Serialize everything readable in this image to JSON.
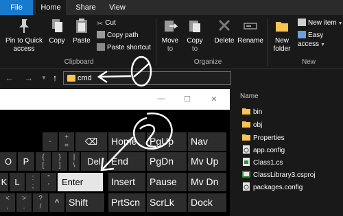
{
  "ribbon_tabs": {
    "file": "File",
    "home": "Home",
    "share": "Share",
    "view": "View"
  },
  "clipboard": {
    "pin_line1": "Pin to Quick",
    "pin_line2": "access",
    "copy": "Copy",
    "paste": "Paste",
    "cut": "Cut",
    "copy_path": "Copy path",
    "paste_shortcut": "Paste shortcut",
    "group_label": "Clipboard"
  },
  "organize": {
    "move_to_line1": "Move",
    "move_to_line2": "to",
    "copy_to_line1": "Copy",
    "copy_to_line2": "to",
    "delete": "Delete",
    "rename": "Rename",
    "group_label": "Organize"
  },
  "new": {
    "new_folder_line1": "New",
    "new_folder_line2": "folder",
    "new_item": "New item",
    "easy_access": "Easy access",
    "group_label": "New"
  },
  "address_bar": {
    "value": "cmd"
  },
  "file_list": {
    "column_header": "Name",
    "items": [
      {
        "name": "bin",
        "icon": "folder-icon"
      },
      {
        "name": "obj",
        "icon": "folder-icon"
      },
      {
        "name": "Properties",
        "icon": "folder-icon"
      },
      {
        "name": "app.config",
        "icon": "config-file-icon"
      },
      {
        "name": "Class1.cs",
        "icon": "csharp-file-icon"
      },
      {
        "name": "ClassLibrary3.csproj",
        "icon": "csproj-file-icon"
      },
      {
        "name": "packages.config",
        "icon": "config-file-icon"
      }
    ]
  },
  "keyboard": {
    "row1": [
      "-",
      "+\n=",
      "⌫",
      "Home",
      "PgUp",
      "Nav"
    ],
    "row2": [
      "O",
      "P",
      "{\n[",
      "}\n]",
      "|\n\\",
      "Del",
      "End",
      "PgDn",
      "Mv Up"
    ],
    "row3": [
      "K",
      "L",
      ":\n;",
      "\"\n'",
      "Enter",
      "Insert",
      "Pause",
      "Mv Dn"
    ],
    "row4": [
      "<\n,",
      ">\n.",
      "?\n/",
      "^",
      "Shift",
      "PrtScn",
      "ScrLk",
      "Dock"
    ]
  },
  "annotations": {
    "step1": "1",
    "step2": "2"
  }
}
